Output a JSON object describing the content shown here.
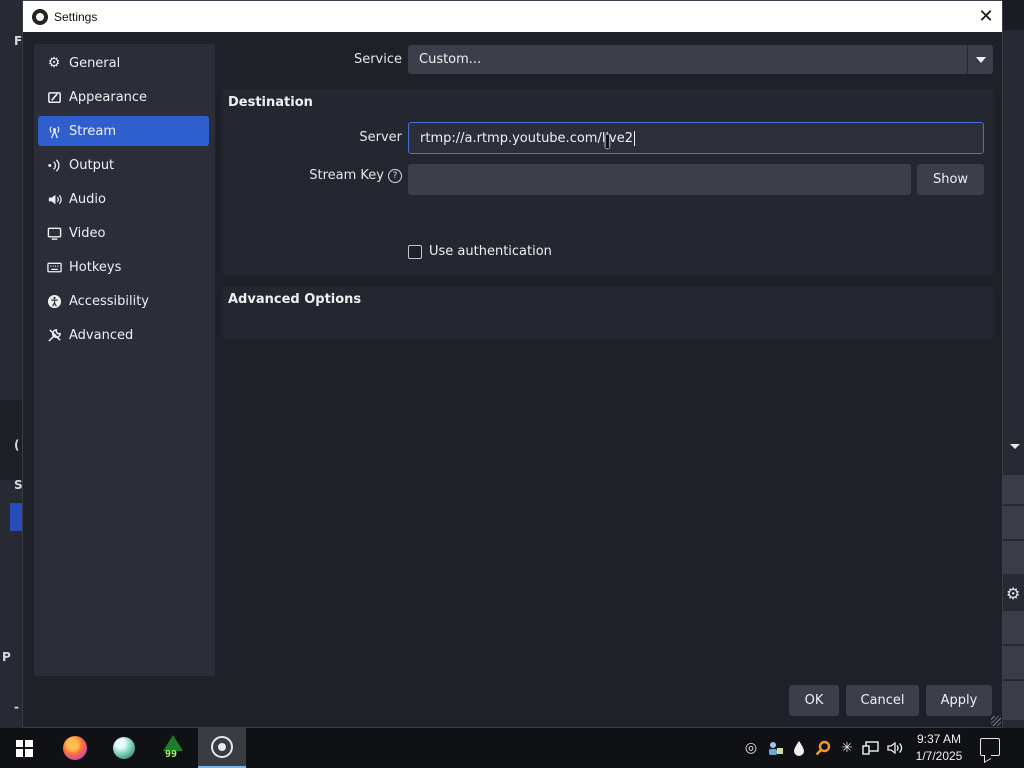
{
  "dialog": {
    "title": "Settings",
    "close_glyph": "✕"
  },
  "sidebar": {
    "items": [
      {
        "label": "General",
        "icon": "gear-icon",
        "active": false
      },
      {
        "label": "Appearance",
        "icon": "paint-icon",
        "active": false
      },
      {
        "label": "Stream",
        "icon": "antenna-icon",
        "active": true
      },
      {
        "label": "Output",
        "icon": "output-icon",
        "active": false
      },
      {
        "label": "Audio",
        "icon": "speaker-icon",
        "active": false
      },
      {
        "label": "Video",
        "icon": "monitor-icon",
        "active": false
      },
      {
        "label": "Hotkeys",
        "icon": "keyboard-icon",
        "active": false
      },
      {
        "label": "Accessibility",
        "icon": "accessibility-icon",
        "active": false
      },
      {
        "label": "Advanced",
        "icon": "wrench-icon",
        "active": false
      }
    ]
  },
  "stream": {
    "service_label": "Service",
    "service_value": "Custom...",
    "destination_heading": "Destination",
    "server_label": "Server",
    "server_value": "rtmp://a.rtmp.youtube.com/live2",
    "stream_key_label": "Stream Key",
    "stream_key_value": "",
    "help_glyph": "?",
    "show_button": "Show",
    "use_auth_label": "Use authentication",
    "use_auth_checked": false,
    "advanced_heading": "Advanced Options"
  },
  "buttons": {
    "ok": "OK",
    "cancel": "Cancel",
    "apply": "Apply"
  },
  "taskbar": {
    "apps": [
      {
        "name": "Firefox",
        "icon": "firefox-icon"
      },
      {
        "name": "Globe app",
        "icon": "globe-icon"
      },
      {
        "name": "Tree app",
        "icon": "tree-icon",
        "badge": "99"
      },
      {
        "name": "OBS Studio",
        "icon": "obs-icon",
        "active": true
      }
    ],
    "clock_time": "9:37 AM",
    "clock_date": "1/7/2025"
  },
  "colors": {
    "accent": "#2f5fcf",
    "dialog_bg": "#1f2129",
    "sidebar_bg": "#2b2e38",
    "group_bg": "#252730",
    "control_bg": "#3c3f49"
  }
}
